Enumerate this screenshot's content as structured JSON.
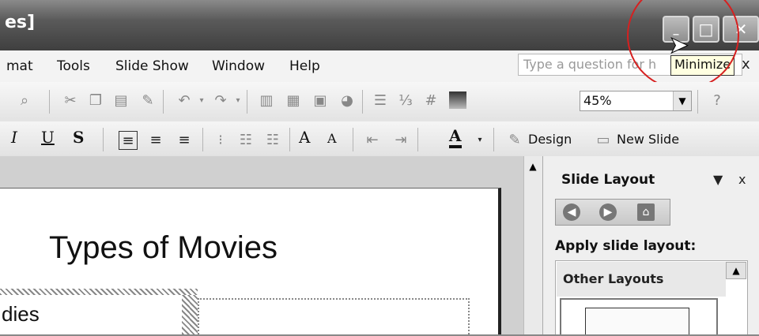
{
  "window": {
    "title_fragment": "es]",
    "minimize_glyph": "_",
    "maximize_glyph": "□",
    "close_glyph": "✕",
    "tooltip": "Minimize"
  },
  "menu": {
    "items": [
      "mat",
      "Tools",
      "Slide Show",
      "Window",
      "Help"
    ]
  },
  "help_box": {
    "placeholder": "Type a question for h",
    "close_glyph": "x"
  },
  "toolbar": {
    "zoom_value": "45%",
    "zoom_arrow": "▼",
    "design_label": "Design",
    "new_slide_label": "New Slide",
    "italic": "I",
    "underline": "U",
    "shadow": "S",
    "grow_font": "A",
    "shrink_font": "A",
    "font_color": "A"
  },
  "slide": {
    "title": "Types of Movies",
    "bullet_fragment": "dies"
  },
  "task_pane": {
    "title": "Slide Layout",
    "menu_glyph": "▼",
    "close_glyph": "x",
    "apply_label": "Apply slide layout:",
    "section_label": "Other Layouts",
    "scroll_up": "▲"
  },
  "icons": {
    "minimize": "minimize-icon",
    "maximize": "maximize-icon",
    "close": "close-icon",
    "cursor": "mouse-pointer-icon"
  },
  "colors": {
    "highlight_circle": "#d62020",
    "tooltip_bg": "#ffffe1"
  }
}
